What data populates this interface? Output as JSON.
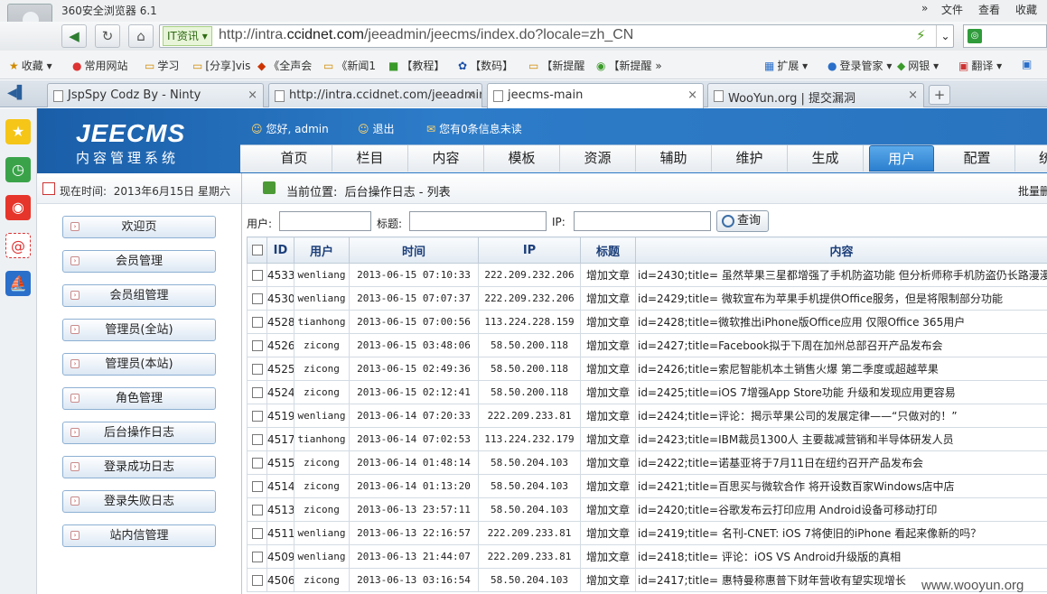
{
  "browser": {
    "app_title": "360安全浏览器 6.1",
    "top_menu": [
      "文件",
      "查看",
      "收藏"
    ],
    "url_tag": "IT资讯",
    "url_prefix": "http://intra.",
    "url_host": "ccidnet.com",
    "url_path": "/jeeadmin/jeecms/index.do?locale=zh_CN",
    "bookmarks": [
      "收藏",
      "常用网站",
      "学习",
      "[分享]vis",
      "《全声会",
      "《新闻1",
      "【教程】",
      "【数码】",
      "【新提醒",
      "【新提醒"
    ],
    "bookmarks_right": [
      "扩展",
      "登录管家",
      "网银",
      "翻译"
    ],
    "tabs": [
      {
        "label": "JspSpy Codz By - Ninty",
        "close": "×"
      },
      {
        "label": "http://intra.ccidnet.com/jeeadmin",
        "close": "×"
      },
      {
        "label": "jeecms-main",
        "close": "×"
      },
      {
        "label": "WooYun.org | 提交漏洞",
        "close": "×"
      }
    ],
    "new_tab": "+"
  },
  "cms": {
    "logo": "JEECMS",
    "logo_sub": "内容管理系统",
    "greeting": "您好, admin",
    "logout": "退出",
    "messages": "您有0条信息未读",
    "nav": [
      "首页",
      "栏目",
      "内容",
      "模板",
      "资源",
      "辅助",
      "维护",
      "生成",
      "用户",
      "配置",
      "统"
    ],
    "current_time_label": "现在时间:",
    "current_time": "2013年6月15日 星期六",
    "location_label": "当前位置:",
    "location": "后台操作日志 - 列表",
    "batch": "批量删",
    "menu": [
      "欢迎页",
      "会员管理",
      "会员组管理",
      "管理员(全站)",
      "管理员(本站)",
      "角色管理",
      "后台操作日志",
      "登录成功日志",
      "登录失败日志",
      "站内信管理"
    ],
    "filter": {
      "user_label": "用户:",
      "title_label": "标题:",
      "ip_label": "IP:",
      "query": "查询"
    },
    "table": {
      "headers": [
        "ID",
        "用户",
        "时间",
        "IP",
        "标题",
        "内容"
      ],
      "rows": [
        [
          "4533",
          "wenliang",
          "2013-06-15 07:10:33",
          "222.209.232.206",
          "增加文章",
          "id=2430;title= 虽然苹果三星都增强了手机防盗功能 但分析师称手机防盗仍长路漫漫"
        ],
        [
          "4530",
          "wenliang",
          "2013-06-15 07:07:37",
          "222.209.232.206",
          "增加文章",
          "id=2429;title= 微软宣布为苹果手机提供Office服务，但是将限制部分功能"
        ],
        [
          "4528",
          "tianhong",
          "2013-06-15 07:00:56",
          "113.224.228.159",
          "增加文章",
          "id=2428;title=微软推出iPhone版Office应用 仅限Office 365用户"
        ],
        [
          "4526",
          "zicong",
          "2013-06-15 03:48:06",
          "58.50.200.118",
          "增加文章",
          "id=2427;title=Facebook拟于下周在加州总部召开产品发布会"
        ],
        [
          "4525",
          "zicong",
          "2013-06-15 02:49:36",
          "58.50.200.118",
          "增加文章",
          "id=2426;title=索尼智能机本土销售火爆 第二季度或超越苹果"
        ],
        [
          "4524",
          "zicong",
          "2013-06-15 02:12:41",
          "58.50.200.118",
          "增加文章",
          "id=2425;title=iOS 7增强App Store功能 升级和发现应用更容易"
        ],
        [
          "4519",
          "wenliang",
          "2013-06-14 07:20:33",
          "222.209.233.81",
          "增加文章",
          "id=2424;title=评论：揭示苹果公司的发展定律——“只做对的！”"
        ],
        [
          "4517",
          "tianhong",
          "2013-06-14 07:02:53",
          "113.224.232.179",
          "增加文章",
          "id=2423;title=IBM裁员1300人 主要裁减营销和半导体研发人员"
        ],
        [
          "4515",
          "zicong",
          "2013-06-14 01:48:14",
          "58.50.204.103",
          "增加文章",
          "id=2422;title=诺基亚将于7月11日在纽约召开产品发布会"
        ],
        [
          "4514",
          "zicong",
          "2013-06-14 01:13:20",
          "58.50.204.103",
          "增加文章",
          "id=2421;title=百思买与微软合作 将开设数百家Windows店中店"
        ],
        [
          "4513",
          "zicong",
          "2013-06-13 23:57:11",
          "58.50.204.103",
          "增加文章",
          "id=2420;title=谷歌发布云打印应用 Android设备可移动打印"
        ],
        [
          "4511",
          "wenliang",
          "2013-06-13 22:16:57",
          "222.209.233.81",
          "增加文章",
          "id=2419;title= 名刊-CNET: iOS 7将使旧的iPhone 看起来像新的吗？"
        ],
        [
          "4509",
          "wenliang",
          "2013-06-13 21:44:07",
          "222.209.233.81",
          "增加文章",
          "id=2418;title= 评论：iOS VS Android升级版的真相"
        ],
        [
          "4506",
          "zicong",
          "2013-06-13 03:16:54",
          "58.50.204.103",
          "增加文章",
          "id=2417;title= 惠特曼称惠普下财年营收有望实现增长"
        ]
      ]
    }
  },
  "watermark": "www.wooyun.org"
}
